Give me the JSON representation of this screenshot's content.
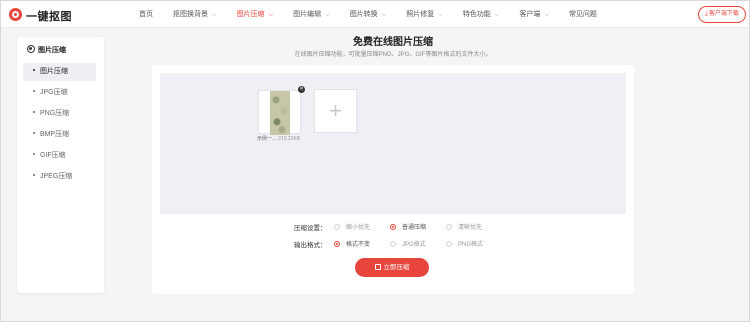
{
  "header": {
    "brand": "一键抠图",
    "nav": [
      {
        "label": "首页",
        "has_caret": false,
        "active": false
      },
      {
        "label": "抠图换背景",
        "has_caret": true,
        "active": false
      },
      {
        "label": "图片压缩",
        "has_caret": true,
        "active": true
      },
      {
        "label": "图片编辑",
        "has_caret": true,
        "active": false
      },
      {
        "label": "图片转换",
        "has_caret": true,
        "active": false
      },
      {
        "label": "照片修复",
        "has_caret": true,
        "active": false
      },
      {
        "label": "特色功能",
        "has_caret": true,
        "active": false
      },
      {
        "label": "客户端",
        "has_caret": true,
        "active": false
      },
      {
        "label": "常见问题",
        "has_caret": false,
        "active": false
      }
    ],
    "download_label": "客户端下载",
    "accent_color": "#e8453c"
  },
  "sidebar": {
    "title": "图片压缩",
    "items": [
      {
        "label": "图片压缩",
        "active": true
      },
      {
        "label": "JPG压缩",
        "active": false
      },
      {
        "label": "PNG压缩",
        "active": false
      },
      {
        "label": "BMP压缩",
        "active": false
      },
      {
        "label": "GIF压缩",
        "active": false
      },
      {
        "label": "JPEG压缩",
        "active": false
      }
    ]
  },
  "main": {
    "title": "免费在线图片压缩",
    "subtitle": "在线图片压缩功能，可批量压缩PNG、JPG、GIF等图片格式的文件大小。",
    "file": {
      "name": "示例一...",
      "size": "210.22KB"
    },
    "add_symbol": "+",
    "compress_settings": {
      "label": "压缩设置：",
      "options": [
        {
          "label": "缩小优先",
          "checked": false
        },
        {
          "label": "普通压缩",
          "checked": true
        },
        {
          "label": "清晰优先",
          "checked": false
        }
      ]
    },
    "output_format": {
      "label": "输出格式：",
      "options": [
        {
          "label": "格式不变",
          "checked": true
        },
        {
          "label": "JPG格式",
          "checked": false
        },
        {
          "label": "PNG格式",
          "checked": false
        }
      ]
    },
    "submit_label": "立即压缩"
  }
}
